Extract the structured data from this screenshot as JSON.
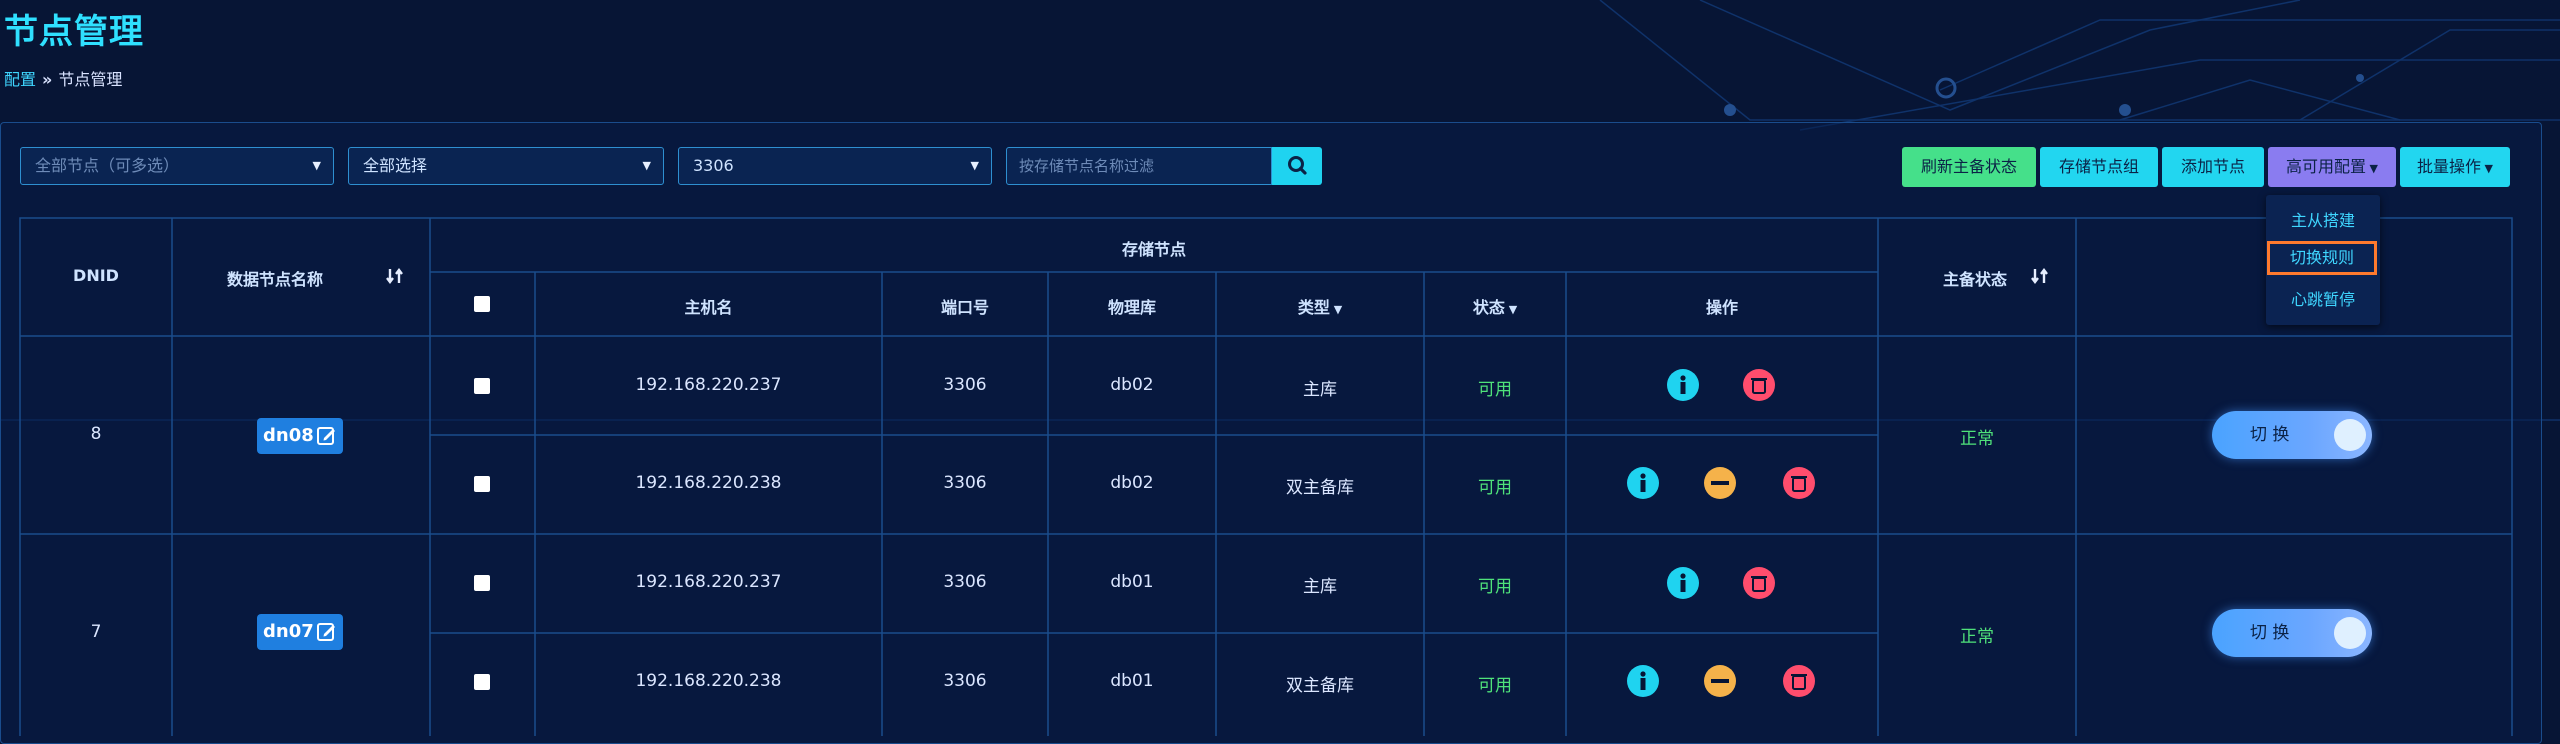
{
  "page": {
    "title": "节点管理"
  },
  "breadcrumb": {
    "parent": "配置",
    "sep": "»",
    "current": "节点管理"
  },
  "filters": {
    "nodes_placeholder": "全部节点（可多选）",
    "select2_value": "全部选择",
    "port_value": "3306",
    "search_placeholder": "按存储节点名称过滤"
  },
  "toolbar": {
    "refresh": "刷新主备状态",
    "storage_group": "存储节点组",
    "add_node": "添加节点",
    "ha_config": "高可用配置",
    "batch": "批量操作"
  },
  "ha_menu": {
    "item1": "主从搭建",
    "item2": "切换规则",
    "item3": "心跳暂停"
  },
  "table": {
    "headers": {
      "dnid": "DNID",
      "data_node_name": "数据节点名称",
      "storage_node": "存储节点",
      "hostname": "主机名",
      "port": "端口号",
      "physical_db": "物理库",
      "type": "类型",
      "status": "状态",
      "ops": "操作",
      "master_status": "主备状态"
    },
    "groups": [
      {
        "dnid": "8",
        "name": "dn08",
        "master_status": "正常",
        "switch_label": "切  换",
        "rows": [
          {
            "host": "192.168.220.237",
            "port": "3306",
            "db": "db02",
            "type": "主库",
            "status": "可用"
          },
          {
            "host": "192.168.220.238",
            "port": "3306",
            "db": "db02",
            "type": "双主备库",
            "status": "可用"
          }
        ]
      },
      {
        "dnid": "7",
        "name": "dn07",
        "master_status": "正常",
        "switch_label": "切  换",
        "rows": [
          {
            "host": "192.168.220.237",
            "port": "3306",
            "db": "db01",
            "type": "主库",
            "status": "可用"
          },
          {
            "host": "192.168.220.238",
            "port": "3306",
            "db": "db01",
            "type": "双主备库",
            "status": "可用"
          }
        ]
      }
    ]
  },
  "colors": {
    "accent": "#2fe0ff",
    "ok": "#4fe27a",
    "btn_green": "#45e08a",
    "btn_cyan": "#22d6f0",
    "btn_purple": "#8a7cf0",
    "info_icon": "#1fd3f0",
    "delete_icon": "#ff4d6d",
    "minus_icon": "#f5b24a"
  },
  "icons": [
    "search-icon",
    "sort-icon",
    "edit-icon",
    "info-icon",
    "delete-icon",
    "minus-icon",
    "refresh-icon",
    "caret-down-icon"
  ]
}
